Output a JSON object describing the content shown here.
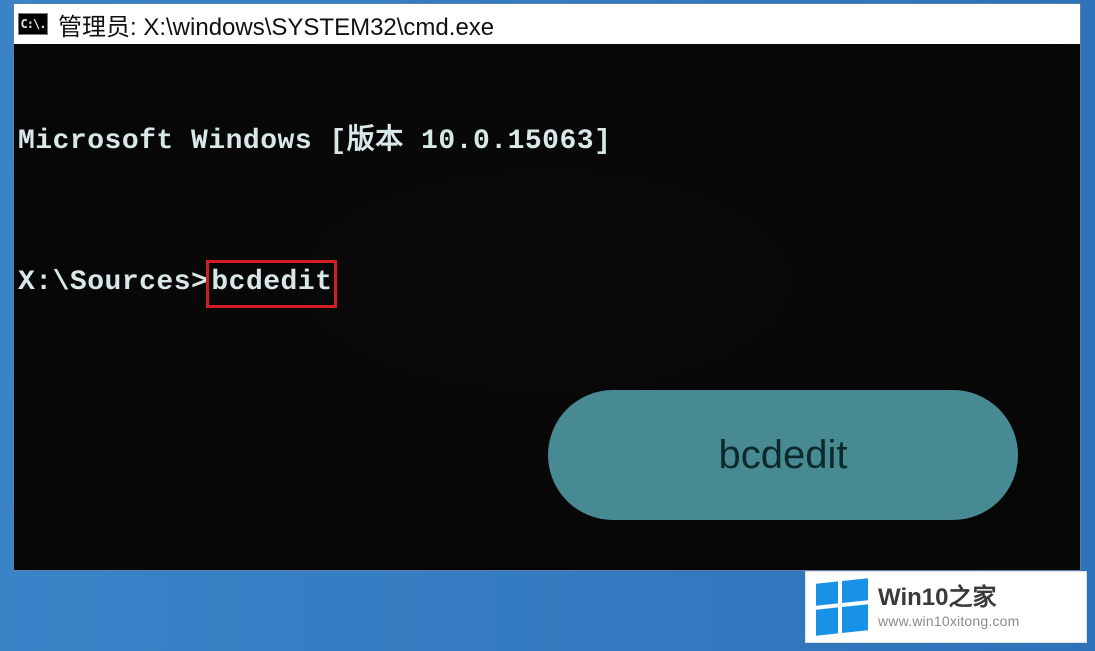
{
  "colors": {
    "desktop_gradient_from": "#3a83c7",
    "desktop_gradient_to": "#2e73ba",
    "console_bg": "#060606",
    "console_fg": "#d8e8e8",
    "highlight_border": "#d21e1e",
    "pill_bg": "#478a93",
    "pill_fg": "#0c2a2a",
    "win_logo": "#1792e6"
  },
  "titlebar": {
    "icon_glyph": "C:\\.",
    "text": "管理员: X:\\windows\\SYSTEM32\\cmd.exe"
  },
  "console": {
    "version_line": "Microsoft Windows [版本 10.0.15063]",
    "prompt": "X:\\Sources>",
    "command": "bcdedit"
  },
  "annotation": {
    "pill_label": "bcdedit"
  },
  "watermark": {
    "title": "Win10之家",
    "url": "www.win10xitong.com"
  }
}
